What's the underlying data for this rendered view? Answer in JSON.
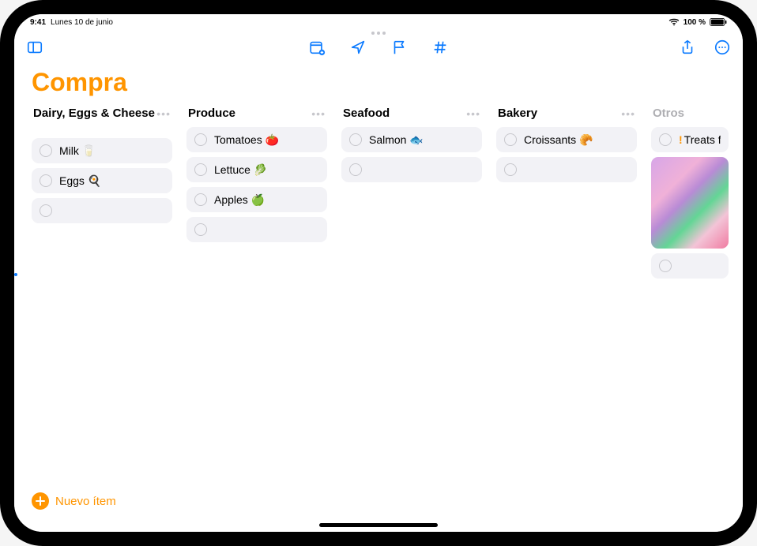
{
  "statusbar": {
    "time": "9:41",
    "date": "Lunes 10 de junio",
    "battery": "100 %"
  },
  "list": {
    "title": "Compra"
  },
  "columns": [
    {
      "title": "Dairy, Eggs & Cheese",
      "tall": true,
      "muted": false,
      "show_menu": true,
      "items": [
        {
          "text": "Milk 🥛",
          "priority": false
        },
        {
          "text": "Eggs 🍳",
          "priority": false
        },
        {
          "text": "",
          "priority": false
        }
      ]
    },
    {
      "title": "Produce",
      "tall": false,
      "muted": false,
      "show_menu": true,
      "items": [
        {
          "text": "Tomatoes 🍅",
          "priority": false
        },
        {
          "text": "Lettuce 🥬",
          "priority": false
        },
        {
          "text": "Apples 🍏",
          "priority": false
        },
        {
          "text": "",
          "priority": false
        }
      ]
    },
    {
      "title": "Seafood",
      "tall": false,
      "muted": false,
      "show_menu": true,
      "items": [
        {
          "text": "Salmon 🐟",
          "priority": false
        },
        {
          "text": "",
          "priority": false
        }
      ]
    },
    {
      "title": "Bakery",
      "tall": false,
      "muted": false,
      "show_menu": true,
      "items": [
        {
          "text": "Croissants 🥐",
          "priority": false
        },
        {
          "text": "",
          "priority": false
        }
      ]
    },
    {
      "title": "Otros",
      "tall": false,
      "muted": true,
      "show_menu": false,
      "items": [
        {
          "text": "Treats for t",
          "priority": true
        }
      ],
      "has_image": true
    }
  ],
  "footer": {
    "new_item_label": "Nuevo ítem"
  }
}
